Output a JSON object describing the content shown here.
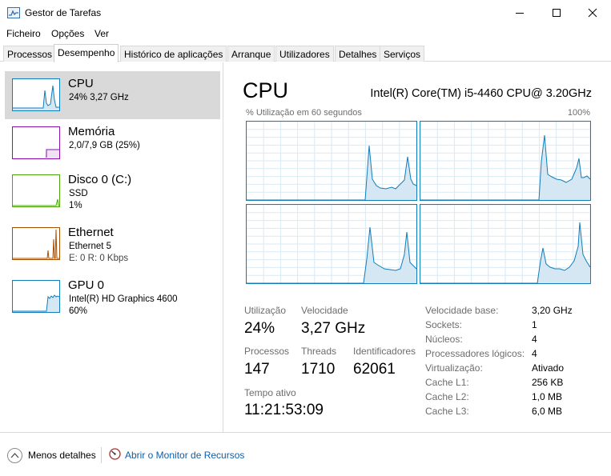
{
  "window": {
    "title": "Gestor de Tarefas"
  },
  "menu": [
    "Ficheiro",
    "Opções",
    "Ver"
  ],
  "tabs": [
    "Processos",
    "Desempenho",
    "Histórico de aplicações",
    "Arranque",
    "Utilizadores",
    "Detalhes",
    "Serviços"
  ],
  "active_tab": "Desempenho",
  "sidebar": {
    "items": [
      {
        "name": "CPU",
        "lines": [
          "24% 3,27 GHz"
        ],
        "color": "#117dbb",
        "selected": true
      },
      {
        "name": "Memória",
        "lines": [
          "2,0/7,9 GB (25%)"
        ],
        "color": "#8b12ae",
        "selected": false
      },
      {
        "name": "Disco 0 (C:)",
        "lines": [
          "SSD",
          "1%"
        ],
        "color": "#4da60c",
        "selected": false
      },
      {
        "name": "Ethernet",
        "lines": [
          "Ethernet 5",
          "E: 0 R: 0 Kbps"
        ],
        "color": "#a74f01",
        "selected": false
      },
      {
        "name": "GPU 0",
        "lines": [
          "Intel(R) HD Graphics 4600",
          "60%"
        ],
        "color": "#117dbb",
        "selected": false
      }
    ]
  },
  "cpu": {
    "title": "CPU",
    "model": "Intel(R) Core(TM) i5-4460 CPU@ 3.20GHz",
    "graph_label": "% Utilização em 60 segundos",
    "graph_max": "100%",
    "stats": {
      "utilizacao_label": "Utilização",
      "utilizacao": "24%",
      "velocidade_label": "Velocidade",
      "velocidade": "3,27 GHz",
      "processos_label": "Processos",
      "processos": "147",
      "threads_label": "Threads",
      "threads": "1710",
      "identificadores_label": "Identificadores",
      "identificadores": "62061",
      "tempo_label": "Tempo ativo",
      "tempo": "11:21:53:09"
    },
    "specs": [
      {
        "label": "Velocidade base:",
        "value": "3,20 GHz"
      },
      {
        "label": "Sockets:",
        "value": "1"
      },
      {
        "label": "Núcleos:",
        "value": "4"
      },
      {
        "label": "Processadores lógicos:",
        "value": "4"
      },
      {
        "label": "Virtualização:",
        "value": "Ativado"
      },
      {
        "label": "Cache L1:",
        "value": "256 KB"
      },
      {
        "label": "Cache L2:",
        "value": "1,0 MB"
      },
      {
        "label": "Cache L3:",
        "value": "6,0 MB"
      }
    ]
  },
  "footer": {
    "less_details": "Menos detalhes",
    "resource_monitor": "Abrir o Monitor de Recursos"
  },
  "colors": {
    "cpu": "#117dbb",
    "cpu_fill": "#f1f6fa",
    "grid": "#d9eaf4",
    "memory": "#8b12ae",
    "disk": "#4da60c",
    "ethernet": "#a74f01",
    "selected_bg": "#d9d9d9",
    "link": "#0b5fae"
  },
  "icons": [
    "task-manager-app-icon",
    "minimize-icon",
    "maximize-icon",
    "close-icon",
    "chevron-up-icon",
    "resource-monitor-icon"
  ]
}
